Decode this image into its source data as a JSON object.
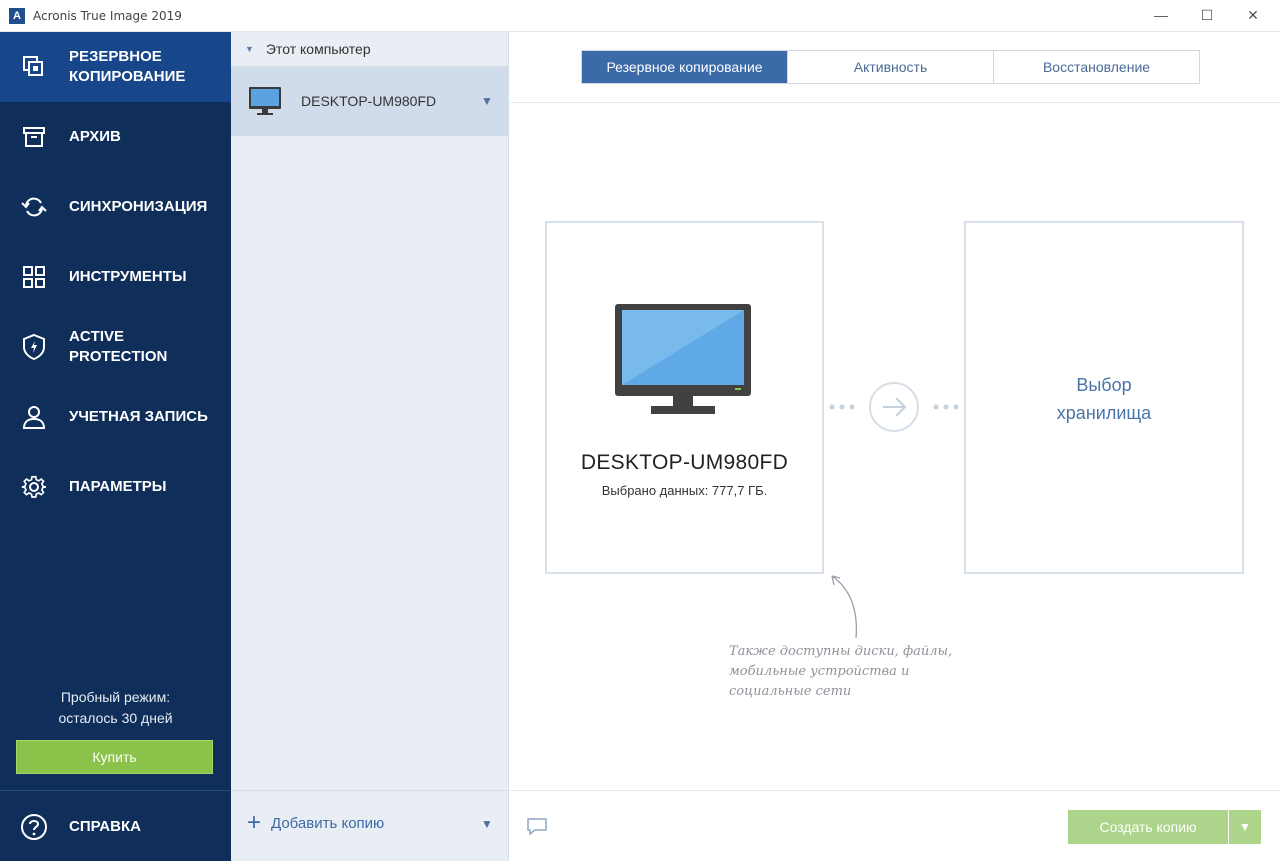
{
  "window": {
    "title": "Acronis True Image 2019",
    "logo_letter": "A",
    "min_glyph": "—",
    "max_glyph": "☐",
    "close_glyph": "✕"
  },
  "nav": {
    "items": [
      {
        "label_line1": "РЕЗЕРВНОЕ",
        "label_line2": "КОПИРОВАНИЕ",
        "icon": "backup-icon",
        "active": true
      },
      {
        "label": "АРХИВ",
        "icon": "archive-icon"
      },
      {
        "label": "СИНХРОНИЗАЦИЯ",
        "icon": "sync-icon"
      },
      {
        "label": "ИНСТРУМЕНТЫ",
        "icon": "tools-icon"
      },
      {
        "label_line1": "ACTIVE",
        "label_line2": "PROTECTION",
        "icon": "shield-icon"
      },
      {
        "label": "УЧЕТНАЯ ЗАПИСЬ",
        "icon": "account-icon"
      },
      {
        "label": "ПАРАМЕТРЫ",
        "icon": "gear-icon"
      }
    ],
    "trial_line1": "Пробный режим:",
    "trial_line2": "осталось 30 дней",
    "buy_label": "Купить",
    "help_label": "СПРАВКА",
    "active_color": "#17478a",
    "bg_color": "#0f2e5a"
  },
  "list": {
    "group_title": "Этот компьютер",
    "computer_name": "DESKTOP-UM980FD",
    "add_copy_label": "Добавить копию"
  },
  "main": {
    "tabs": [
      {
        "label": "Резервное копирование",
        "active": true
      },
      {
        "label": "Активность"
      },
      {
        "label": "Восстановление"
      }
    ],
    "source_name": "DESKTOP-UM980FD",
    "source_data": "Выбрано данных: 777,7 ГБ.",
    "dest_line1": "Выбор",
    "dest_line2": "хранилища",
    "hint_line1": "Также доступны диски, файлы,",
    "hint_line2": "мобильные устройства и",
    "hint_line3": "социальные сети",
    "create_label": "Создать копию",
    "accent_green": "#8bc34a"
  }
}
